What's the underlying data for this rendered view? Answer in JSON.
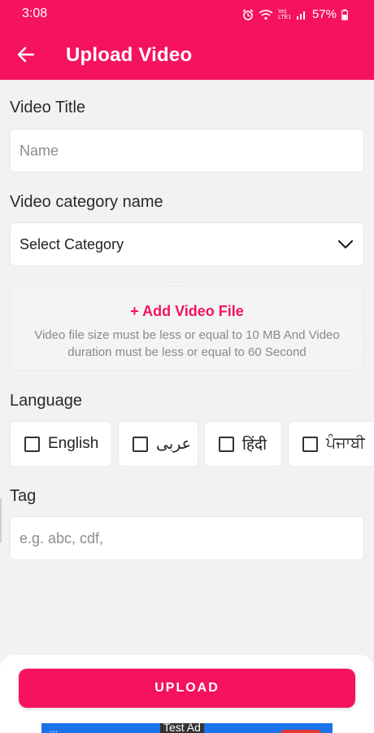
{
  "status": {
    "time": "3:08",
    "network": "Vo) LTE1",
    "battery": "57%"
  },
  "header": {
    "title": "Upload Video"
  },
  "form": {
    "title_label": "Video Title",
    "title_placeholder": "Name",
    "category_label": "Video category name",
    "category_value": "Select Category",
    "add_file": "+ Add Video File",
    "file_hint": "Video file size must be less or equal to 10 MB And Video duration must be less or equal to 60 Second",
    "language_label": "Language",
    "languages": [
      "English",
      "عربى",
      "हिंदी",
      "ਪੰਜਾਬੀ"
    ],
    "tag_label": "Tag",
    "tag_placeholder": "e.g. abc, cdf,"
  },
  "footer": {
    "upload_label": "UPLOAD"
  },
  "ad": {
    "tag": "Test Ad",
    "text": "..."
  },
  "colors": {
    "accent": "#f5135e",
    "background": "#f2f2f2"
  }
}
